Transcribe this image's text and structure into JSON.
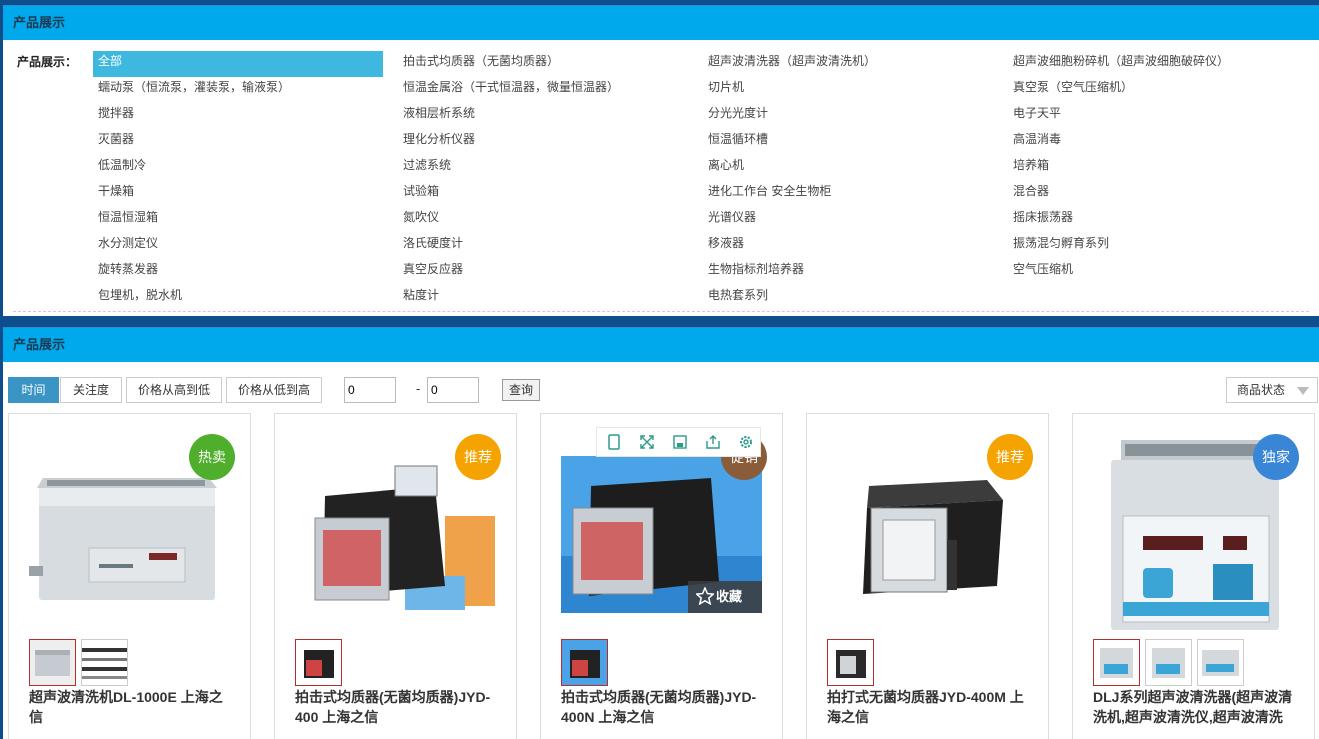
{
  "category_panel": {
    "header": "产品展示",
    "label": "产品展示：",
    "items": [
      "全部",
      "拍击式均质器（无菌均质器）",
      "超声波清洗器（超声波清洗机）",
      "超声波细胞粉碎机（超声波细胞破碎仪）",
      "蠕动泵（恒流泵，灌装泵，输液泵）",
      "恒温金属浴（干式恒温器，微量恒温器）",
      "切片机",
      "真空泵（空气压缩机）",
      "搅拌器",
      "液相层析系统",
      "分光光度计",
      "电子天平",
      "灭菌器",
      "理化分析仪器",
      "恒温循环槽",
      "高温消毒",
      "低温制冷",
      "过滤系统",
      "离心机",
      "培养箱",
      "干燥箱",
      "试验箱",
      "进化工作台 安全生物柜",
      "混合器",
      "恒温恒湿箱",
      "氮吹仪",
      "光谱仪器",
      "摇床振荡器",
      "水分测定仪",
      "洛氏硬度计",
      "移液器",
      "振荡混匀孵育系列",
      "旋转蒸发器",
      "真空反应器",
      "生物指标剂培养器",
      "空气压缩机",
      "包埋机，脱水机",
      "粘度计",
      "电热套系列"
    ]
  },
  "list_panel": {
    "header": "产品展示",
    "sort_tabs": [
      "时间",
      "关注度",
      "价格从高到低",
      "价格从低到高"
    ],
    "price_min": "0",
    "price_max": "0",
    "price_separator": "-",
    "query_label": "查询",
    "status_select": "商品状态",
    "products": [
      {
        "badge": "热卖",
        "badge_color": "#4fae2c",
        "title": "超声波清洗机DL-1000E 上海之信",
        "thumbs": 2
      },
      {
        "badge": "推荐",
        "badge_color": "#f5a300",
        "title": "拍击式均质器(无菌均质器)JYD-400 上海之信",
        "thumbs": 1
      },
      {
        "badge": "促销",
        "badge_color": "#8a5c3a",
        "title": "拍击式均质器(无菌均质器)JYD-400N 上海之信",
        "thumbs": 1,
        "favorite_label": "收藏"
      },
      {
        "badge": "推荐",
        "badge_color": "#f5a300",
        "title": "拍打式无菌均质器JYD-400M 上海之信",
        "thumbs": 1
      },
      {
        "badge": "独家",
        "badge_color": "#3a86d6",
        "title": "DLJ系列超声波清洗器(超声波清洗机,超声波清洗仪,超声波清洗",
        "thumbs": 3
      }
    ]
  }
}
